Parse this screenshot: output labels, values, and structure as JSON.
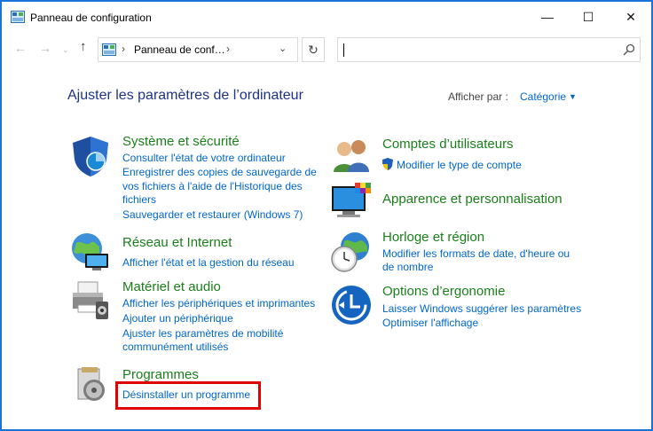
{
  "window": {
    "title": "Panneau de configuration",
    "controls": {
      "minimize": "—",
      "maximize": "☐",
      "close": "✕"
    }
  },
  "nav": {
    "back": "←",
    "forward": "→",
    "recent": "⌄",
    "up": "↑",
    "breadcrumb_sep": "›",
    "address": "Panneau de conf…",
    "address_sep2": "›",
    "dropdown": "⌄",
    "refresh": "↻"
  },
  "header": {
    "title": "Ajuster les paramètres de l’ordinateur",
    "view_by_label": "Afficher par :",
    "view_by_value": "Catégorie"
  },
  "categories": {
    "system": {
      "title": "Système et sécurité",
      "links": [
        "Consulter l'état de votre ordinateur",
        "Enregistrer des copies de sauvegarde de",
        "vos fichiers à l'aide de l'Historique des",
        "fichiers",
        "Sauvegarder et restaurer (Windows 7)"
      ]
    },
    "network": {
      "title": "Réseau et Internet",
      "links": [
        "Afficher l'état et la gestion du réseau"
      ]
    },
    "hardware": {
      "title": "Matériel et audio",
      "links": [
        "Afficher les périphériques et imprimantes",
        "Ajouter un périphérique",
        "Ajuster les paramètres de mobilité",
        "communément utilisés"
      ]
    },
    "programs": {
      "title": "Programmes",
      "links": [
        "Désinstaller un programme"
      ]
    },
    "users": {
      "title": "Comptes d’utilisateurs",
      "links": [
        "Modifier le type de compte"
      ]
    },
    "appearance": {
      "title": "Apparence et personnalisation",
      "links": []
    },
    "clock": {
      "title": "Horloge et région",
      "links": [
        "Modifier les formats de date, d'heure ou",
        "de nombre"
      ]
    },
    "ease": {
      "title": "Options d’ergonomie",
      "links": [
        "Laisser Windows suggérer les paramètres",
        "Optimiser l'affichage"
      ]
    }
  },
  "colors": {
    "accent_border": "#1a73d9",
    "category_title": "#1a7f1a",
    "link": "#0066cc",
    "page_title": "#1e3287",
    "highlight": "#e00000"
  }
}
